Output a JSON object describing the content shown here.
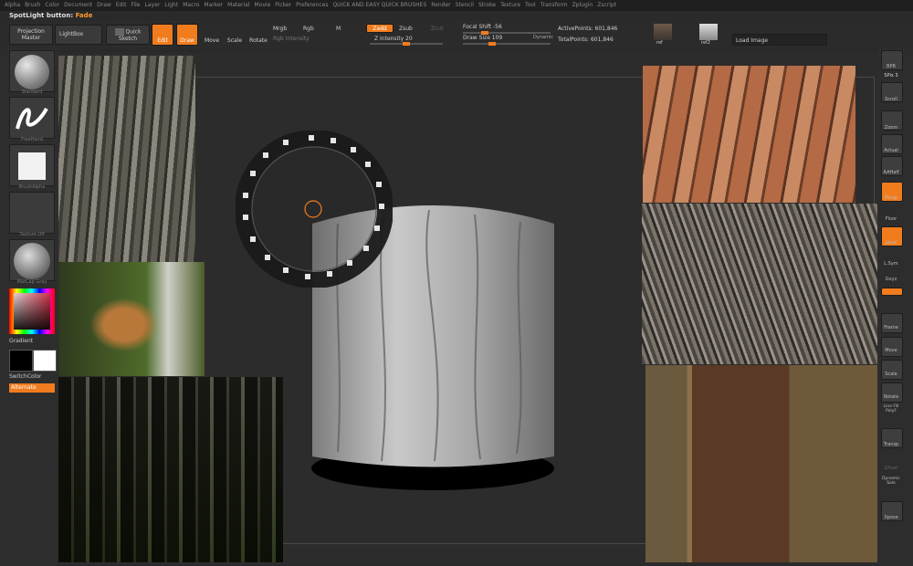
{
  "menu": [
    "Alpha",
    "Brush",
    "Color",
    "Document",
    "Draw",
    "Edit",
    "File",
    "Layer",
    "Light",
    "Macro",
    "Marker",
    "Material",
    "Movie",
    "Picker",
    "Preferences",
    "QUICK AND EASY QUICK BRUSHES",
    "Render",
    "Stencil",
    "Stroke",
    "Texture",
    "Tool",
    "Transform",
    "Zplugin",
    "Zscript"
  ],
  "spotlight": {
    "label": "SpotLight button:",
    "value": "Fade"
  },
  "toolbar": {
    "projection_master": "Projection Master",
    "lightbox": "LightBox",
    "quick_sketch": "Quick Sketch",
    "edit": "Edit",
    "draw": "Draw",
    "move": "Move",
    "scale": "Scale",
    "rotate": "Rotate",
    "mrgb": "Mrgb",
    "rgb": "Rgb",
    "m": "M",
    "rgb_intensity": "Rgb Intensity",
    "zadd": "Zadd",
    "zsub": "Zsub",
    "zcut": "Zcut",
    "z_intensity": "Z Intensity 20",
    "focal_shift": "Focal Shift -56",
    "draw_size": "Draw Size 109",
    "dynamic": "Dynamic",
    "active_points": "ActivePoints: 601,846",
    "total_points": "TotalPoints: 601,846",
    "ref1": "ref",
    "ref2": "ref2",
    "load_image": "Load Image"
  },
  "left_shelf": {
    "brush": "Standard",
    "stroke": "FreeHand",
    "alpha": "BrushAlpha",
    "texture": "Texture Off",
    "material": "MatCap Gray",
    "gradient": "Gradient",
    "switch_color": "SwitchColor",
    "alternate": "Alternate"
  },
  "right_shelf": [
    "BPR",
    "SPix 3",
    "Scroll",
    "Zoom",
    "Actual",
    "AAHalf",
    "Persp",
    "Floor",
    "Local",
    "L.Sym",
    "Gxyz",
    "Frame",
    "Move",
    "Scale",
    "Rotate",
    "Line Fill PolyF",
    "Transp",
    "Ghost",
    "Dynamic Solo",
    "Xpose"
  ],
  "colors": {
    "accent": "#f07c1e",
    "bg": "#2a2a2a"
  }
}
